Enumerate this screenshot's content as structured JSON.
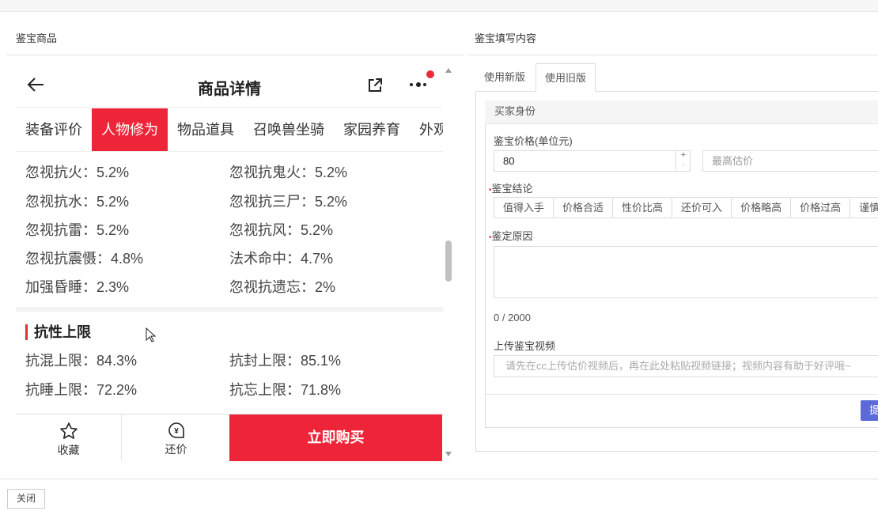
{
  "left_panel": {
    "title": "鉴宝商品"
  },
  "phone": {
    "header_title": "商品详情",
    "categories": [
      "装备评价",
      "人物修为",
      "物品道具",
      "召唤兽坐骑",
      "家园养育",
      "外观"
    ],
    "active_category": 1,
    "stats": [
      {
        "l": "忽视抗火：5.2%",
        "r": "忽视抗鬼火：5.2%"
      },
      {
        "l": "忽视抗水：5.2%",
        "r": "忽视抗三尸：5.2%"
      },
      {
        "l": "忽视抗雷：5.2%",
        "r": "忽视抗风：5.2%"
      },
      {
        "l": "忽视抗震慑：4.8%",
        "r": "法术命中：4.7%"
      },
      {
        "l": "加强昏睡：2.3%",
        "r": "忽视抗遗忘：2%"
      }
    ],
    "section_title": "抗性上限",
    "limits": [
      {
        "l": "抗混上限：84.3%",
        "r": "抗封上限：85.1%"
      },
      {
        "l": "抗睡上限：72.2%",
        "r": "抗忘上限：71.8%"
      }
    ],
    "favorite": "收藏",
    "bargain": "还价",
    "buy": "立即购买"
  },
  "right_panel": {
    "title": "鉴宝填写内容",
    "tabs": [
      "使用新版",
      "使用旧版"
    ],
    "section": "买家身份",
    "price_label": "鉴宝价格(单位元)",
    "price_value": "80",
    "max_placeholder": "最高估价",
    "conclusion_label": "鉴宝结论",
    "conclusions": [
      "值得入手",
      "价格合适",
      "性价比高",
      "还价可入",
      "价格略高",
      "价格过高",
      "谨慎购"
    ],
    "reason_label": "鉴定原因",
    "counter": "0 / 2000",
    "video_label": "上传鉴宝视频",
    "video_placeholder": "请先在cc上传估价视频后，再在此处粘贴视频链接；视频内容有助于好评哦~",
    "submit": "提"
  },
  "footer": {
    "close": "关闭"
  }
}
